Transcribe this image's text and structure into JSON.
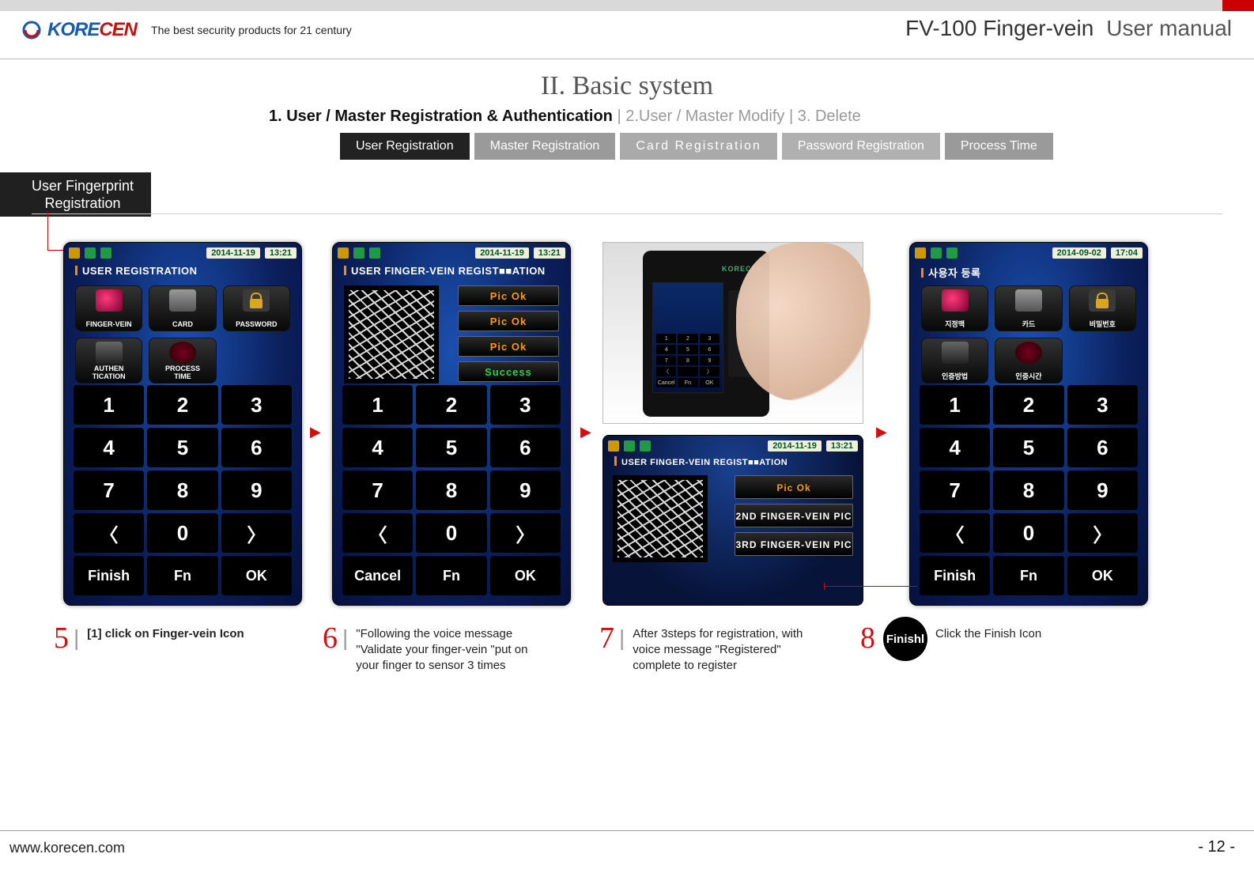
{
  "header": {
    "brand_blue": "KORE",
    "brand_red": "CEN",
    "tagline": "The best security products for 21 century",
    "product": "FV-100 Finger-vein",
    "manual": "User manual"
  },
  "title": "II. Basic system",
  "breadcrumb": {
    "bold": "1. User / Master Registration & Authentication",
    "sep1": " | ",
    "grey1": "2.User / Master Modify",
    "sep2": " | ",
    "grey2": "3. Delete"
  },
  "tabs": {
    "t1": "User Registration",
    "t2": "Master Registration",
    "t3": "Card Registration",
    "t4": "Password Registration",
    "t5": "Process Time"
  },
  "cornerTab": {
    "l1": "User Fingerprint",
    "l2": "Registration"
  },
  "statusbar": {
    "date1": "2014-11-19",
    "time1": "13:21",
    "date4": "2014-09-02",
    "time4": "17:04"
  },
  "screen1": {
    "title": "USER REGISTRATION",
    "icons": {
      "fv": "FINGER-VEIN",
      "card": "CARD",
      "pw": "PASSWORD",
      "auth_l1": "AUTHEN",
      "auth_l2": "TICATION",
      "proc_l1": "PROCESS",
      "proc_l2": "TIME"
    }
  },
  "screen2": {
    "title": "USER FINGER-VEIN REGIST■■ATION",
    "pic": "Pic Ok",
    "suc": "Success",
    "cancel": "Cancel"
  },
  "photo": {
    "brand": "KORECEN"
  },
  "smallDev": {
    "title": "USER FINGER-VEIN REGIST■■ATION",
    "pic": "Pic Ok",
    "b2": "2ND FINGER-VEIN PIC",
    "b3": "3RD FINGER-VEIN PIC"
  },
  "screen4": {
    "title": "사용자 등록",
    "icons": {
      "fv": "지정맥",
      "card": "카드",
      "pw": "비밀번호",
      "auth": "인증방법",
      "proc": "인증시간"
    }
  },
  "keys": {
    "k1": "1",
    "k2": "2",
    "k3": "3",
    "k4": "4",
    "k5": "5",
    "k6": "6",
    "k7": "7",
    "k8": "8",
    "k9": "9",
    "lt": "〈",
    "zero": "0",
    "gt": "〉",
    "finish": "Finish",
    "fn": "Fn",
    "ok": "OK"
  },
  "steps": {
    "n5": "5",
    "n6": "6",
    "n7": "7",
    "n8": "8",
    "t5": "[1] click on Finger-vein Icon",
    "t6": "\"Following the voice message \"Validate your finger-vein \"put on your finger to sensor 3 times",
    "t7": "After 3steps for registration, with voice message \"Registered\" complete to register",
    "t8": "Click the Finish Icon",
    "badge": "Finishl"
  },
  "footer": {
    "url": "www.korecen.com",
    "page": "- 12 -"
  }
}
